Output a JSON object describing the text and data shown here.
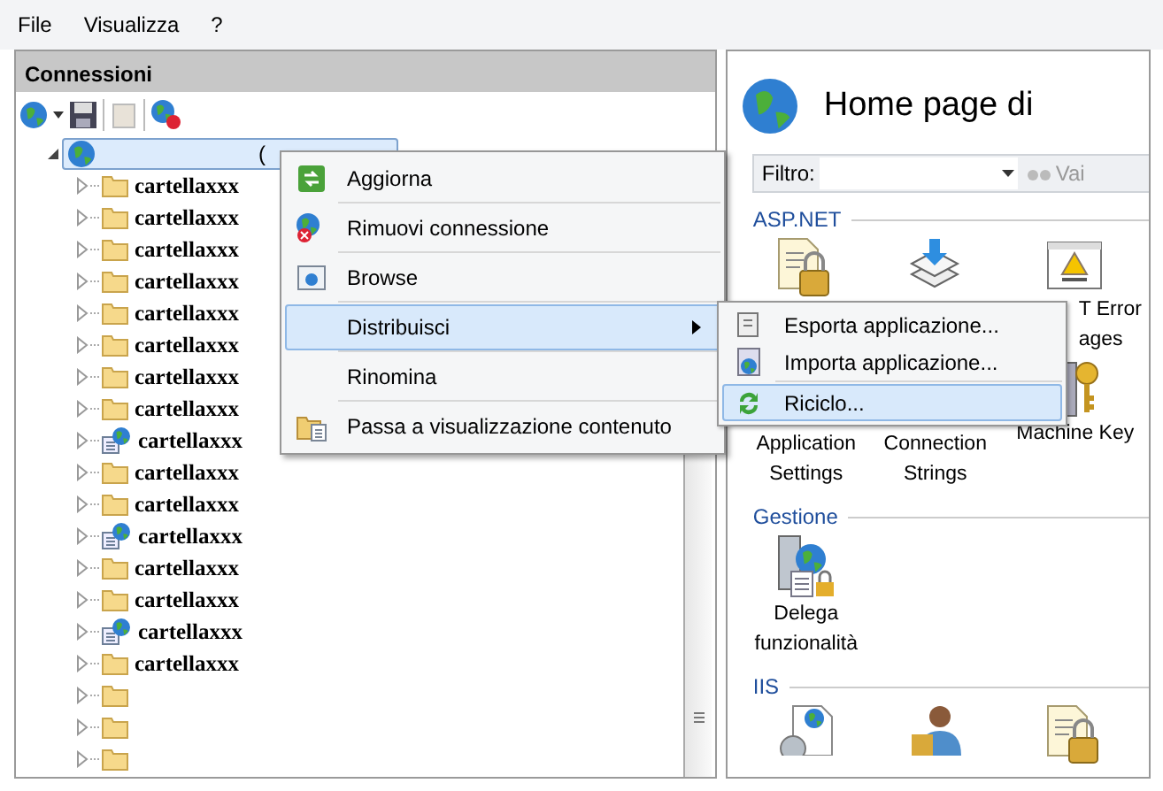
{
  "menu_bar": [
    {
      "label": "File"
    },
    {
      "label": "Visualizza"
    },
    {
      "label": "?"
    }
  ],
  "connections_panel": {
    "title": "Connessioni",
    "tree": {
      "kind": "site",
      "label": "(",
      "expanded": true,
      "selected": true,
      "children": [
        {
          "kind": "folder",
          "label": "cartellaxxx",
          "expanded": false
        },
        {
          "kind": "folder",
          "label": "cartellaxxx",
          "expanded": false
        },
        {
          "kind": "folder",
          "label": "cartellaxxx",
          "expanded": false
        },
        {
          "kind": "folder",
          "label": "cartellaxxx",
          "expanded": false
        },
        {
          "kind": "folder",
          "label": "cartellaxxx",
          "expanded": false
        },
        {
          "kind": "folder",
          "label": "cartellaxxx",
          "expanded": false
        },
        {
          "kind": "folder",
          "label": "cartellaxxx",
          "expanded": false
        },
        {
          "kind": "folder",
          "label": "cartellaxxx",
          "expanded": false
        },
        {
          "kind": "app",
          "label": "cartellaxxx",
          "expanded": false
        },
        {
          "kind": "folder",
          "label": "cartellaxxx",
          "expanded": false
        },
        {
          "kind": "folder",
          "label": "cartellaxxx",
          "expanded": false
        },
        {
          "kind": "app",
          "label": "cartellaxxx",
          "expanded": false
        },
        {
          "kind": "folder",
          "label": "cartellaxxx",
          "expanded": false
        },
        {
          "kind": "folder",
          "label": "cartellaxxx",
          "expanded": false
        },
        {
          "kind": "app",
          "label": "cartellaxxx",
          "expanded": false
        },
        {
          "kind": "folder",
          "label": "cartellaxxx",
          "expanded": false
        },
        {
          "kind": "folder",
          "expanded": false
        },
        {
          "kind": "folder",
          "expanded": false
        },
        {
          "kind": "folder",
          "expanded": false
        }
      ]
    }
  },
  "home": {
    "title": "Home page di",
    "filter": {
      "label": "Filtro:",
      "go_button": "Vai"
    },
    "sections": [
      {
        "title": "ASP.NET",
        "tiles": [
          {
            "kind": "lockpage"
          },
          {
            "kind": "stack"
          },
          {
            "kind": "errorpage",
            "label_lines": [
              "T Error",
              "ages"
            ]
          },
          {
            "kind": "hidden",
            "label_lines": [
              "Application",
              "Settings"
            ]
          },
          {
            "kind": "hidden",
            "label_lines": [
              "Connection",
              "Strings"
            ]
          },
          {
            "kind": "keyserver",
            "label_lines": [
              "Machine Key"
            ]
          }
        ]
      },
      {
        "title": "Gestione",
        "tiles": [
          {
            "kind": "delegation",
            "label_lines": [
              "Delega",
              "funzionalità"
            ]
          }
        ]
      },
      {
        "title": "IIS",
        "tiles": [
          {
            "kind": "gearpage"
          },
          {
            "kind": "userlock"
          },
          {
            "kind": "lockpage"
          }
        ]
      }
    ]
  },
  "context_menu": {
    "items": [
      {
        "kind": "refresh",
        "label": "Aggiorna",
        "selected": false,
        "submenu": false
      },
      {
        "kind": "remove",
        "label": "Rimuovi connessione",
        "selected": false,
        "submenu": false
      },
      {
        "kind": "browse",
        "label": "Browse",
        "selected": false,
        "submenu": false
      },
      {
        "kind": "none",
        "label": "Distribuisci",
        "selected": true,
        "submenu": true
      },
      {
        "kind": "none",
        "label": "Rinomina",
        "selected": false,
        "submenu": false
      },
      {
        "kind": "content",
        "label": "Passa a visualizzazione contenuto",
        "selected": false,
        "submenu": false
      }
    ]
  },
  "submenu": {
    "items": [
      {
        "kind": "export",
        "label": "Esporta applicazione...",
        "selected": false,
        "separator_before": false
      },
      {
        "kind": "import",
        "label": "Importa applicazione...",
        "selected": false,
        "separator_before": false
      },
      {
        "kind": "recycle",
        "label": "Riciclo...",
        "selected": true,
        "separator_before": true
      }
    ]
  }
}
